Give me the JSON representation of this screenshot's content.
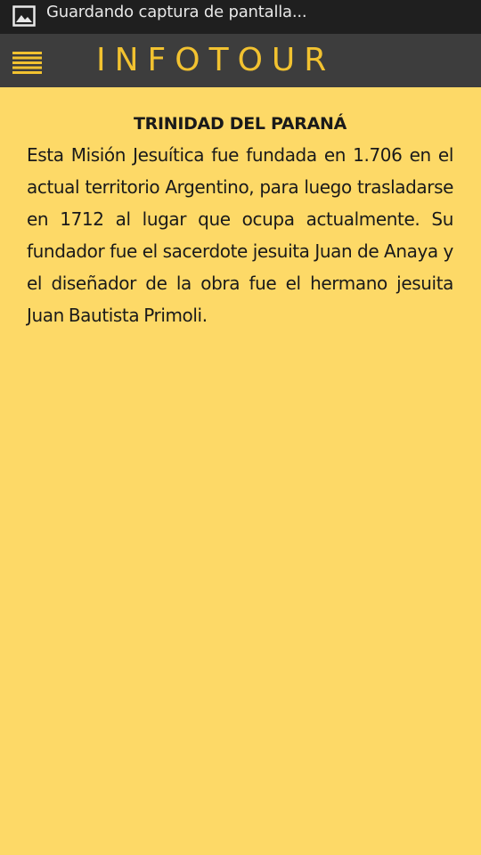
{
  "status_bar": {
    "icon": "image-icon",
    "text": "Guardando captura de pantalla..."
  },
  "header": {
    "menu_icon": "hamburger-menu-icon",
    "title": "INFOTOUR"
  },
  "article": {
    "title": "TRINIDAD DEL PARANÁ",
    "body": "Esta Misión Jesuítica fue fundada en 1.706 en el actual territorio Argentino, para luego trasladarse en 1712 al lugar que ocupa actualmente. Su fundador fue el sacerdote jesuita Juan de Anaya y el diseñador de la obra fue el hermano jesuita Juan Bautista Primoli."
  },
  "colors": {
    "background": "#fdd967",
    "status_bar": "#1f1f1f",
    "header": "#3d3d3d",
    "accent": "#f2c230",
    "text": "#1a1a1a"
  }
}
